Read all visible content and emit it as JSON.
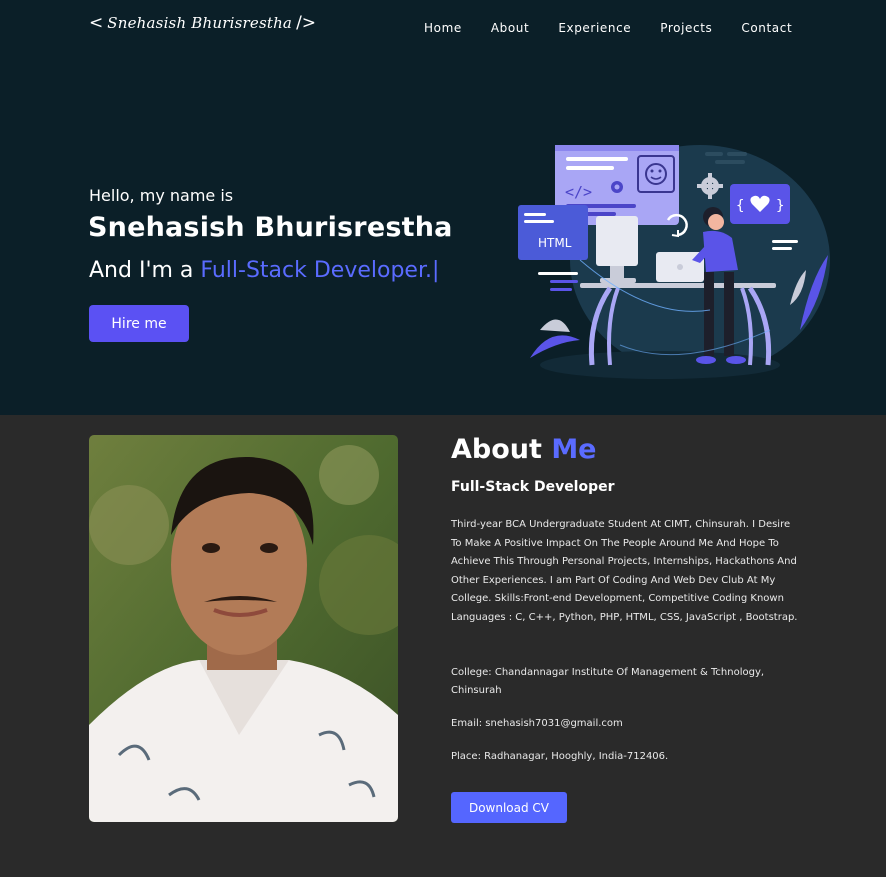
{
  "nav": {
    "logo_prefix": "<",
    "logo_signature": "Snehasish Bhurisrestha",
    "logo_suffix": "/>",
    "links": [
      "Home",
      "About",
      "Experience",
      "Projects",
      "Contact"
    ]
  },
  "hero": {
    "greeting": "Hello, my name is",
    "name": "Snehasish Bhurisrestha",
    "role_prefix": "And I'm a ",
    "role_accent": "Full-Stack Developer.",
    "caret": "|",
    "hire_label": "Hire me",
    "illustration": {
      "html_label": "HTML"
    }
  },
  "about": {
    "title_main": "About ",
    "title_accent": "Me",
    "subtitle": "Full-Stack Developer",
    "bio": "Third-year BCA Undergraduate Student At CIMT, Chinsurah. I Desire To Make A Positive Impact On The People Around Me And Hope To Achieve This Through Personal Projects, Internships, Hackathons And Other Experiences. I am Part Of Coding And Web Dev Club At My College. Skills:Front-end Development, Competitive Coding Known Languages : C, C++, Python, PHP, HTML, CSS, JavaScript , Bootstrap.",
    "college": "College: Chandannagar Institute Of Management & Tchnology, Chinsurah",
    "email": "Email: snehasish7031@gmail.com",
    "place": "Place: Radhanagar, Hooghly, India-712406.",
    "cv_label": "Download CV"
  },
  "colors": {
    "hero_bg": "#0b1f28",
    "about_bg": "#2a2a2a",
    "accent": "#5a6bff",
    "button": "#5b51f3"
  }
}
